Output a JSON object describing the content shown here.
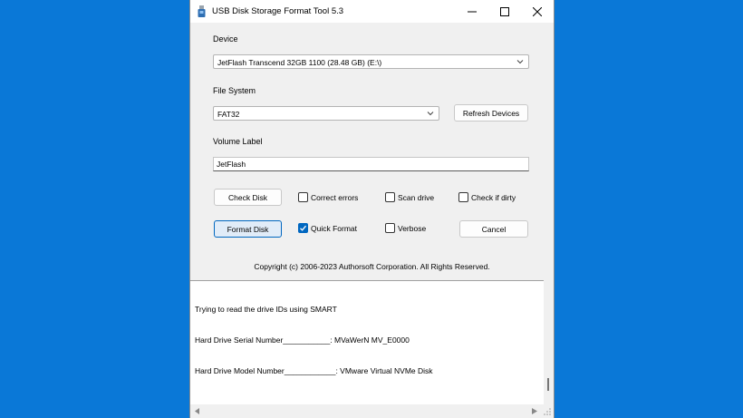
{
  "window": {
    "title": "USB Disk Storage Format Tool 5.3"
  },
  "device": {
    "label": "Device",
    "selected": "JetFlash  Transcend 32GB  1100 (28.48 GB) (E:\\)"
  },
  "file_system": {
    "label": "File System",
    "selected": "FAT32",
    "refresh_button": "Refresh Devices"
  },
  "volume_label": {
    "label": "Volume Label",
    "value": "JetFlash"
  },
  "actions": {
    "check_disk": "Check Disk",
    "format_disk": "Format Disk",
    "cancel": "Cancel"
  },
  "options": {
    "correct_errors": {
      "label": "Correct errors",
      "checked": false
    },
    "scan_drive": {
      "label": "Scan drive",
      "checked": false
    },
    "check_if_dirty": {
      "label": "Check if dirty",
      "checked": false
    },
    "quick_format": {
      "label": "Quick Format",
      "checked": true
    },
    "verbose": {
      "label": "Verbose",
      "checked": false
    }
  },
  "copyright": "Copyright (c) 2006-2023 Authorsoft Corporation. All Rights Reserved.",
  "log": [
    "Trying to read the drive IDs using SMART",
    "Hard Drive Serial Number___________: MVaWerN MV_E0000",
    "Hard Drive Model Number____________: VMware Virtual NVMe Disk"
  ],
  "colors": {
    "desktop": "#0a78d7",
    "accent": "#0067c0"
  },
  "icons": {
    "app": "usb-drive-icon",
    "minimize": "minimize-icon",
    "maximize": "maximize-icon",
    "close": "close-icon"
  }
}
